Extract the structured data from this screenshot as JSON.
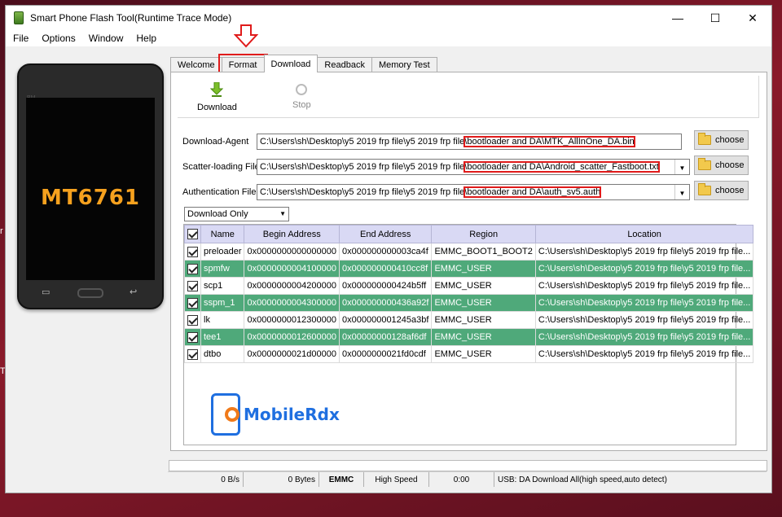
{
  "window": {
    "title": "Smart Phone Flash Tool(Runtime Trace Mode)",
    "controls": {
      "minimize": "—",
      "maximize": "☐",
      "close": "✕"
    }
  },
  "menu": [
    "File",
    "Options",
    "Window",
    "Help"
  ],
  "phone": {
    "brand": "BM",
    "chip": "MT6761"
  },
  "tabs": [
    {
      "label": "Welcome",
      "active": false
    },
    {
      "label": "Format",
      "active": false,
      "highlighted": true
    },
    {
      "label": "Download",
      "active": true
    },
    {
      "label": "Readback",
      "active": false
    },
    {
      "label": "Memory Test",
      "active": false
    }
  ],
  "toolbar": {
    "download_label": "Download",
    "stop_label": "Stop"
  },
  "fields": {
    "download_agent": {
      "label": "Download-Agent",
      "prefix": "C:\\Users\\sh\\Desktop\\y5 2019 frp file\\y5 2019 frp file",
      "highlight": "\\bootloader and DA\\MTK_AllInOne_DA.bin"
    },
    "scatter": {
      "label": "Scatter-loading File",
      "prefix": "C:\\Users\\sh\\Desktop\\y5 2019 frp file\\y5 2019 frp file",
      "highlight": "\\bootloader and DA\\Android_scatter_Fastboot.txt"
    },
    "auth": {
      "label": "Authentication File",
      "prefix": "C:\\Users\\sh\\Desktop\\y5 2019 frp file\\y5 2019 frp file",
      "highlight": "\\bootloader and DA\\auth_sv5.auth"
    },
    "choose_label": "choose"
  },
  "mode": {
    "selected": "Download Only"
  },
  "table": {
    "headers": [
      "Name",
      "Begin Address",
      "End Address",
      "Region",
      "Location"
    ],
    "rows": [
      {
        "checked": true,
        "name": "preloader",
        "begin": "0x0000000000000000",
        "end": "0x000000000003ca4f",
        "region": "EMMC_BOOT1_BOOT2",
        "location": "C:\\Users\\sh\\Desktop\\y5 2019 frp file\\y5 2019 frp file...",
        "highlight": false
      },
      {
        "checked": true,
        "name": "spmfw",
        "begin": "0x0000000004100000",
        "end": "0x000000000410cc8f",
        "region": "EMMC_USER",
        "location": "C:\\Users\\sh\\Desktop\\y5 2019 frp file\\y5 2019 frp file...",
        "highlight": true
      },
      {
        "checked": true,
        "name": "scp1",
        "begin": "0x0000000004200000",
        "end": "0x000000000424b5ff",
        "region": "EMMC_USER",
        "location": "C:\\Users\\sh\\Desktop\\y5 2019 frp file\\y5 2019 frp file...",
        "highlight": false
      },
      {
        "checked": true,
        "name": "sspm_1",
        "begin": "0x0000000004300000",
        "end": "0x000000000436a92f",
        "region": "EMMC_USER",
        "location": "C:\\Users\\sh\\Desktop\\y5 2019 frp file\\y5 2019 frp file...",
        "highlight": true
      },
      {
        "checked": true,
        "name": "lk",
        "begin": "0x0000000012300000",
        "end": "0x000000001245a3bf",
        "region": "EMMC_USER",
        "location": "C:\\Users\\sh\\Desktop\\y5 2019 frp file\\y5 2019 frp file...",
        "highlight": false
      },
      {
        "checked": true,
        "name": "tee1",
        "begin": "0x0000000012600000",
        "end": "0x00000000128af6df",
        "region": "EMMC_USER",
        "location": "C:\\Users\\sh\\Desktop\\y5 2019 frp file\\y5 2019 frp file...",
        "highlight": true
      },
      {
        "checked": true,
        "name": "dtbo",
        "begin": "0x0000000021d00000",
        "end": "0x0000000021fd0cdf",
        "region": "EMMC_USER",
        "location": "C:\\Users\\sh\\Desktop\\y5 2019 frp file\\y5 2019 frp file...",
        "highlight": false
      }
    ]
  },
  "watermark": {
    "text": "MobileRdx"
  },
  "status": {
    "speed": "0 B/s",
    "bytes": "0 Bytes",
    "storage": "EMMC",
    "mode": "High Speed",
    "time": "0:00",
    "usb": "USB: DA Download All(high speed,auto detect)"
  },
  "colors": {
    "highlight_row": "#4fa97a",
    "annotation": "#e01b1b",
    "header": "#d9d9f4"
  }
}
